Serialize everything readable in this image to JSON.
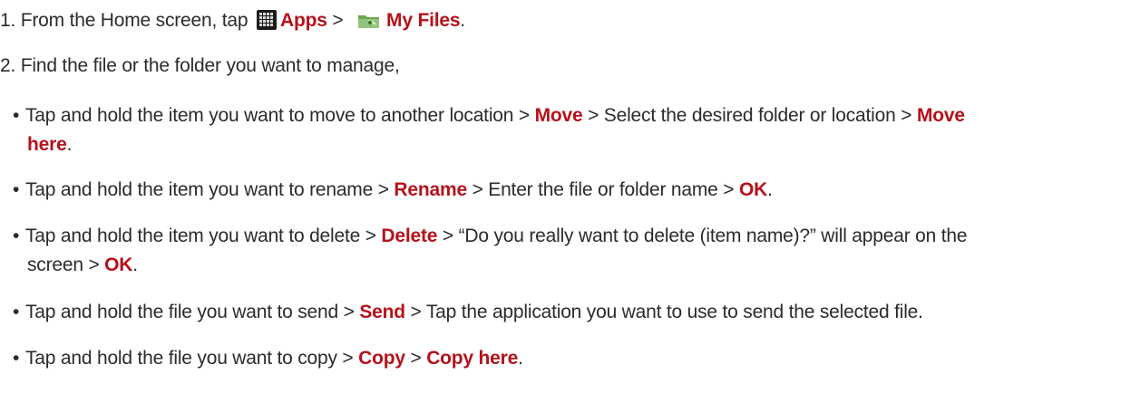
{
  "steps": {
    "step1": {
      "prefix": "1. From the Home screen, tap ",
      "apps": "Apps",
      "sep": " > ",
      "my_files": "My Files",
      "end": "."
    },
    "step2": {
      "text": "2. Find the file or the folder you want to manage,"
    }
  },
  "bullets": {
    "move": {
      "t1": "Tap and hold the item you want to move to another location > ",
      "k1": "Move",
      "t2": " > Select the desired folder or location > ",
      "k2": "Move",
      "k3": "here",
      "end": "."
    },
    "rename": {
      "t1": "Tap and hold the item you want to rename > ",
      "k1": "Rename",
      "t2": " > Enter the file or folder name > ",
      "k2": "OK",
      "end": "."
    },
    "delete": {
      "t1": "Tap and hold the item you want to delete > ",
      "k1": "Delete",
      "t2": " > “Do you really want to delete (item name)?” will appear on the",
      "t3": "screen > ",
      "k2": "OK",
      "end": "."
    },
    "send": {
      "t1": "Tap and hold the file you want to send > ",
      "k1": "Send",
      "t2": " > Tap the application you want to use to send the selected file."
    },
    "copy": {
      "t1": "Tap and hold the file you want to copy > ",
      "k1": "Copy",
      "t2": " > ",
      "k2": "Copy here",
      "end": "."
    }
  },
  "bullet_char": "•",
  "colors": {
    "keyword": "#b5121b",
    "text": "#2b2b2b"
  },
  "icons": {
    "apps": "apps-grid-icon",
    "my_files": "my-files-folder-icon"
  }
}
